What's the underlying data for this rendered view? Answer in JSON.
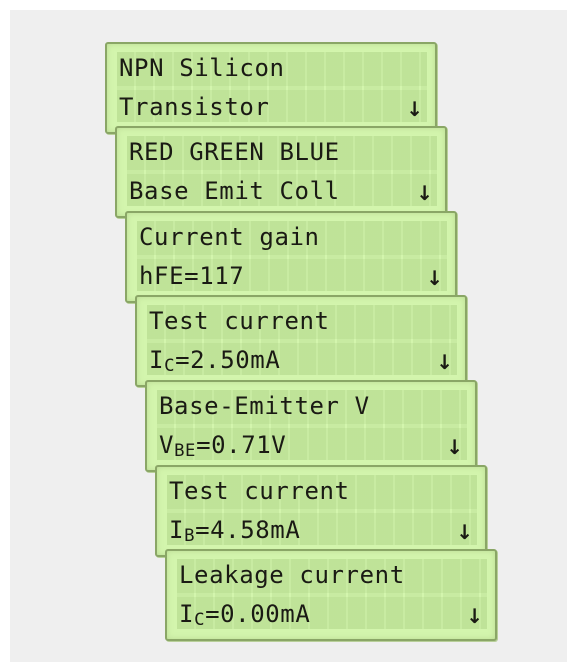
{
  "screens": [
    {
      "line1": "NPN Silicon",
      "line2": "Transistor",
      "arrow": "↓"
    },
    {
      "line1": "RED GREEN BLUE",
      "line2": "Base Emit Coll",
      "arrow": "↓"
    },
    {
      "line1": "Current gain",
      "line2": "hFE=117",
      "arrow": "↓"
    },
    {
      "line1": "Test current",
      "line2_prefix": "I",
      "line2_sub": "C",
      "line2_rest": "=2.50mA",
      "arrow": "↓"
    },
    {
      "line1": "Base-Emitter V",
      "line2_prefix": "V",
      "line2_sub": "BE",
      "line2_rest": "=0.71V",
      "arrow": "↓"
    },
    {
      "line1": "Test current",
      "line2_prefix": "I",
      "line2_sub": "B",
      "line2_rest": "=4.58mA",
      "arrow": "↓"
    },
    {
      "line1": "Leakage current",
      "line2_prefix": "I",
      "line2_sub": "C",
      "line2_rest": "=0.00mA",
      "arrow": "↓"
    }
  ],
  "colors": {
    "lcd_background": "#d3f5ad",
    "lcd_border": "#8aa666",
    "text": "#1a1a14"
  }
}
